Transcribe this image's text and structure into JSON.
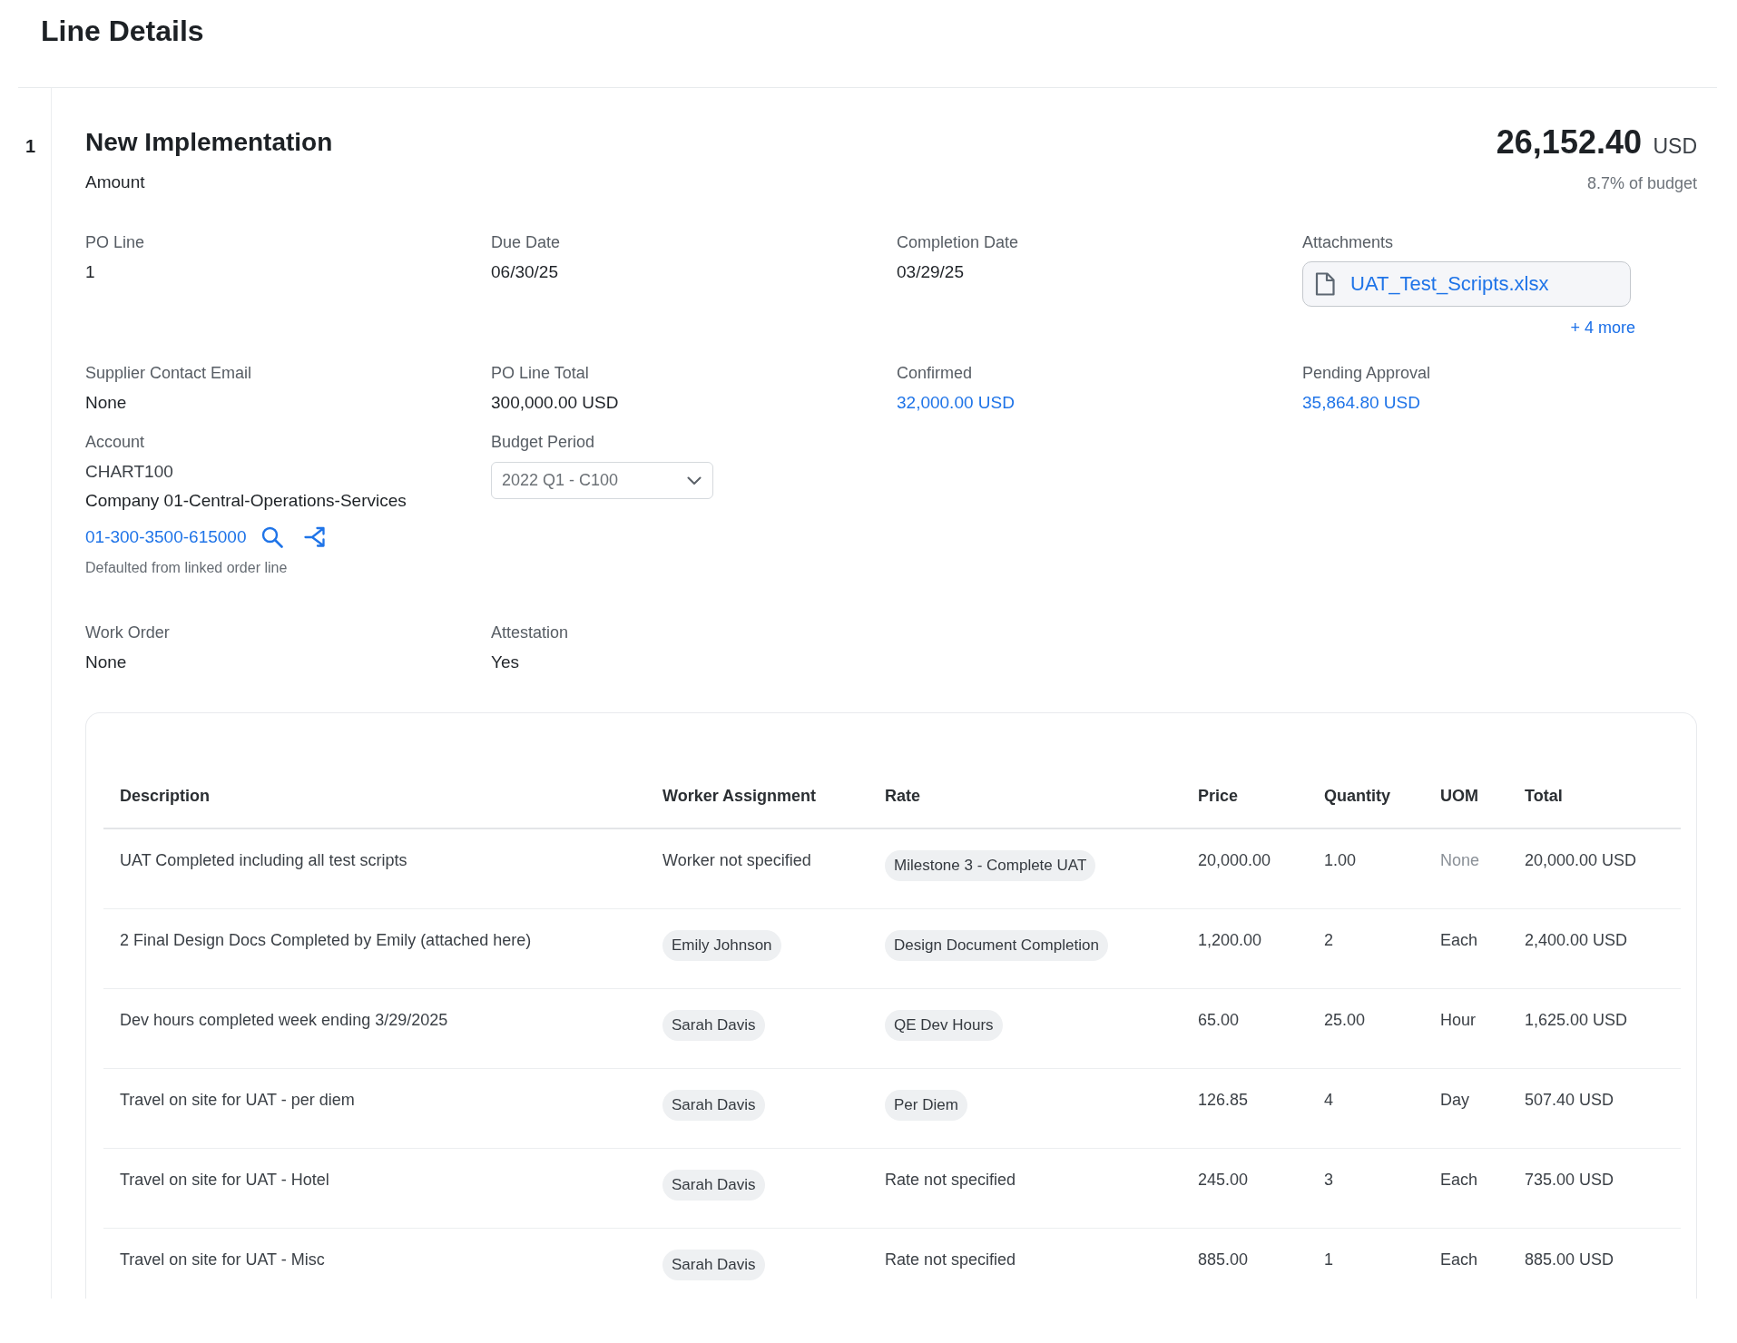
{
  "page": {
    "title": "Line Details"
  },
  "line": {
    "number": "1",
    "title": "New Implementation",
    "subtitle": "Amount",
    "amount": "26,152.40",
    "currency": "USD",
    "budget_share": "8.7% of budget"
  },
  "field_rows": [
    [
      {
        "label": "PO Line",
        "kind": "text",
        "value": "1"
      },
      {
        "label": "Due Date",
        "kind": "text",
        "value": "06/30/25"
      },
      {
        "label": "Completion Date",
        "kind": "text",
        "value": "03/29/25"
      },
      {
        "label": "Attachments",
        "kind": "attachments",
        "file": "UAT_Test_Scripts.xlsx",
        "more": "+ 4 more"
      }
    ],
    [
      {
        "label": "Supplier Contact Email",
        "kind": "text",
        "value": "None"
      },
      {
        "label": "PO Line Total",
        "kind": "text",
        "value": "300,000.00 USD"
      },
      {
        "label": "Confirmed",
        "kind": "link",
        "value": "32,000.00 USD"
      },
      {
        "label": "Pending Approval",
        "kind": "link",
        "value": "35,864.80 USD"
      }
    ],
    [
      {
        "label": "Account",
        "kind": "account",
        "code": "CHART100",
        "name": "Company 01-Central-Operations-Services",
        "segment": "01-300-3500-615000",
        "note": "Defaulted from linked order line"
      },
      {
        "label": "Budget Period",
        "kind": "select",
        "value": "2022 Q1 - C100"
      }
    ],
    [
      {
        "label": "Work Order",
        "kind": "text",
        "value": "None"
      },
      {
        "label": "Attestation",
        "kind": "text",
        "value": "Yes"
      }
    ]
  ],
  "table": {
    "columns": [
      "Description",
      "Worker Assignment",
      "Rate",
      "Price",
      "Quantity",
      "UOM",
      "Total"
    ],
    "rows": [
      {
        "cells": [
          {
            "kind": "text",
            "text": "UAT Completed including all test scripts"
          },
          {
            "kind": "text",
            "text": "Worker not specified"
          },
          {
            "kind": "tag",
            "text": "Milestone 3 - Complete UAT"
          },
          {
            "kind": "text",
            "text": "20,000.00"
          },
          {
            "kind": "text",
            "text": "1.00"
          },
          {
            "kind": "muted",
            "text": "None"
          },
          {
            "kind": "text",
            "text": "20,000.00 USD"
          }
        ]
      },
      {
        "cells": [
          {
            "kind": "text",
            "text": "2 Final Design Docs Completed by Emily (attached here)"
          },
          {
            "kind": "tag",
            "text": "Emily Johnson"
          },
          {
            "kind": "tag",
            "text": "Design Document Completion"
          },
          {
            "kind": "text",
            "text": "1,200.00"
          },
          {
            "kind": "text",
            "text": "2"
          },
          {
            "kind": "text",
            "text": "Each"
          },
          {
            "kind": "text",
            "text": "2,400.00 USD"
          }
        ]
      },
      {
        "cells": [
          {
            "kind": "text",
            "text": "Dev hours completed week ending 3/29/2025"
          },
          {
            "kind": "tag",
            "text": "Sarah Davis"
          },
          {
            "kind": "tag",
            "text": "QE Dev Hours"
          },
          {
            "kind": "text",
            "text": "65.00"
          },
          {
            "kind": "text",
            "text": "25.00"
          },
          {
            "kind": "text",
            "text": "Hour"
          },
          {
            "kind": "text",
            "text": "1,625.00 USD"
          }
        ]
      },
      {
        "cells": [
          {
            "kind": "text",
            "text": "Travel on site for UAT - per diem"
          },
          {
            "kind": "tag",
            "text": "Sarah Davis"
          },
          {
            "kind": "tag",
            "text": "Per Diem"
          },
          {
            "kind": "text",
            "text": "126.85"
          },
          {
            "kind": "text",
            "text": "4"
          },
          {
            "kind": "text",
            "text": "Day"
          },
          {
            "kind": "text",
            "text": "507.40 USD"
          }
        ]
      },
      {
        "cells": [
          {
            "kind": "text",
            "text": "Travel on site for UAT - Hotel"
          },
          {
            "kind": "tag",
            "text": "Sarah Davis"
          },
          {
            "kind": "text",
            "text": "Rate not specified"
          },
          {
            "kind": "text",
            "text": "245.00"
          },
          {
            "kind": "text",
            "text": "3"
          },
          {
            "kind": "text",
            "text": "Each"
          },
          {
            "kind": "text",
            "text": "735.00 USD"
          }
        ]
      },
      {
        "cells": [
          {
            "kind": "text",
            "text": "Travel on site for UAT - Misc"
          },
          {
            "kind": "tag",
            "text": "Sarah Davis"
          },
          {
            "kind": "text",
            "text": "Rate not specified"
          },
          {
            "kind": "text",
            "text": "885.00"
          },
          {
            "kind": "text",
            "text": "1"
          },
          {
            "kind": "text",
            "text": "Each"
          },
          {
            "kind": "text",
            "text": "885.00 USD"
          }
        ]
      }
    ]
  }
}
